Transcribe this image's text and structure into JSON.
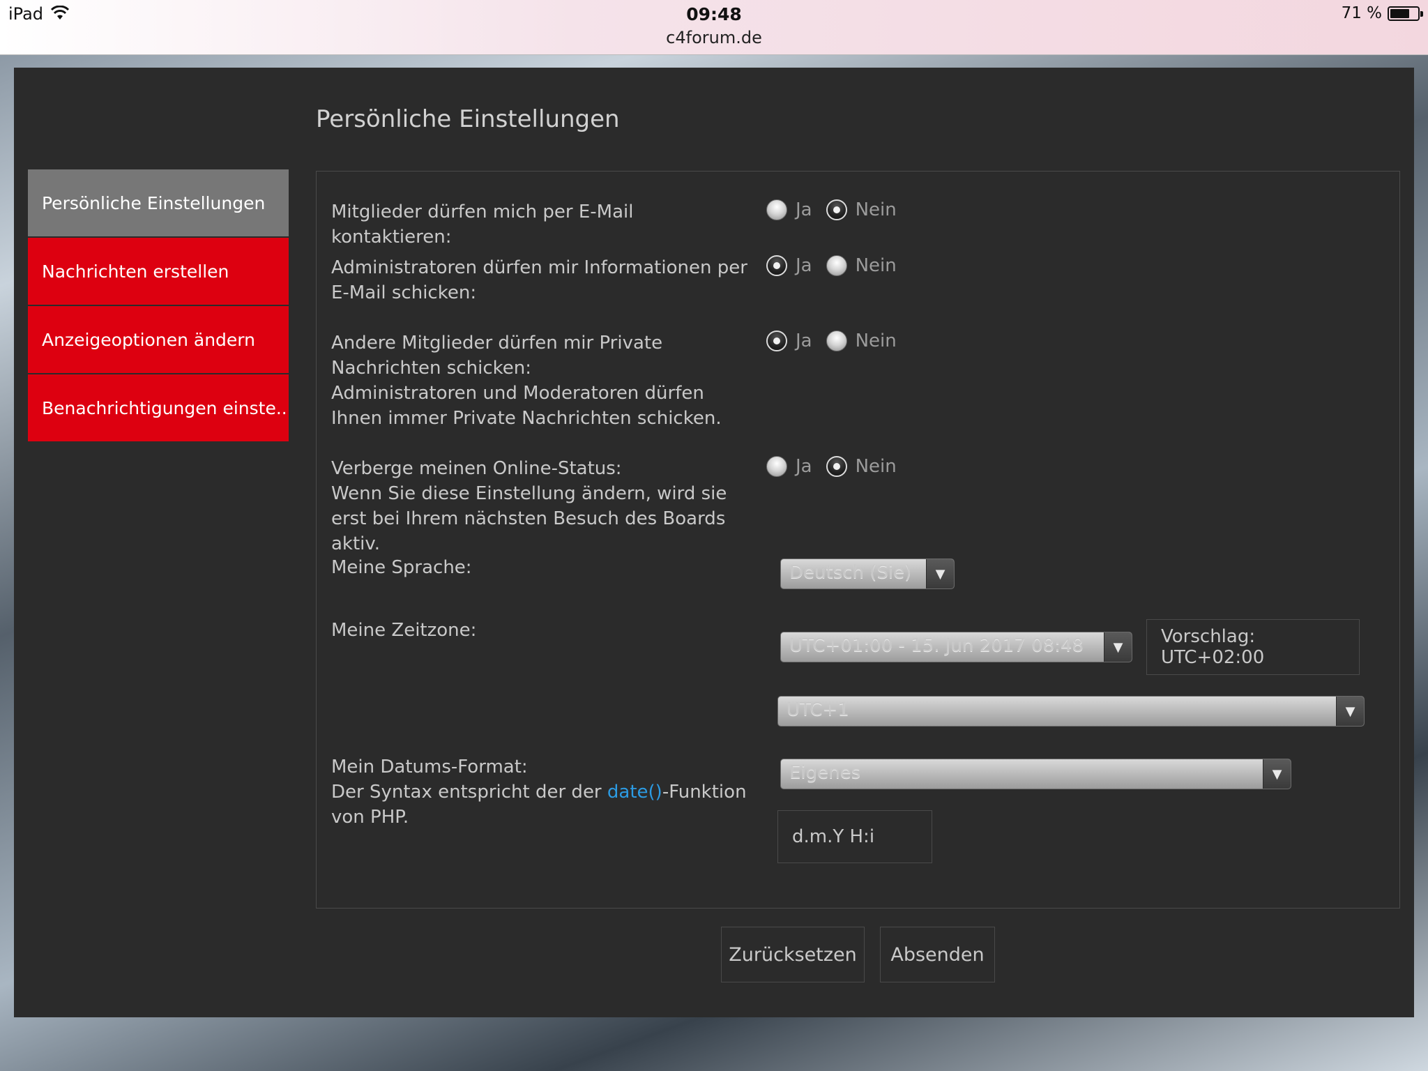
{
  "statusbar": {
    "device": "iPad",
    "time": "09:48",
    "url": "c4forum.de",
    "battery": "71 %",
    "battery_level": 0.71
  },
  "page": {
    "title": "Persönliche Einstellungen"
  },
  "sidebar": {
    "items": [
      {
        "label": "Persönliche Einstellungen",
        "active": true
      },
      {
        "label": "Nachrichten erstellen",
        "active": false
      },
      {
        "label": "Anzeigeoptionen ändern",
        "active": false
      },
      {
        "label": "Benachrichtigungen einste...",
        "active": false
      }
    ]
  },
  "form": {
    "yes_label": "Ja",
    "no_label": "Nein",
    "email_contact": {
      "label": "Mitglieder dürfen mich per E-Mail kontaktieren:",
      "value": "Nein"
    },
    "admin_email": {
      "label": "Administratoren dürfen mir Informationen per E-Mail schicken:",
      "value": "Ja"
    },
    "private_messages": {
      "label": "Andere Mitglieder dürfen mir Private Nachrichten schicken:",
      "explain": "Administratoren und Moderatoren dürfen Ihnen immer Private Nachrichten schicken.",
      "value": "Ja"
    },
    "hide_online": {
      "label": "Verberge meinen Online-Status:",
      "explain": "Wenn Sie diese Einstellung ändern, wird sie erst bei Ihrem nächsten Besuch des Boards aktiv.",
      "value": "Nein"
    },
    "language": {
      "label": "Meine Sprache:",
      "value": "Deutsch (Sie)"
    },
    "timezone": {
      "label": "Meine Zeitzone:",
      "date_value": "UTC+01:00 - 15. Jun 2017 08:48",
      "suggestion": "Vorschlag: UTC+02:00",
      "zone_value": "UTC+1"
    },
    "date_format": {
      "label": "Mein Datums-Format:",
      "explain_prefix": "Der Syntax entspricht der der ",
      "explain_link": "date()",
      "explain_suffix": "-Funktion von PHP.",
      "select_value": "Eigenes",
      "custom_value": "d.m.Y H:i"
    },
    "reset_button": "Zurücksetzen",
    "submit_button": "Absenden"
  },
  "colors": {
    "panel": "#2b2b2b",
    "nav_red": "#dd0010",
    "nav_active": "#777777",
    "link": "#2c9be3"
  }
}
